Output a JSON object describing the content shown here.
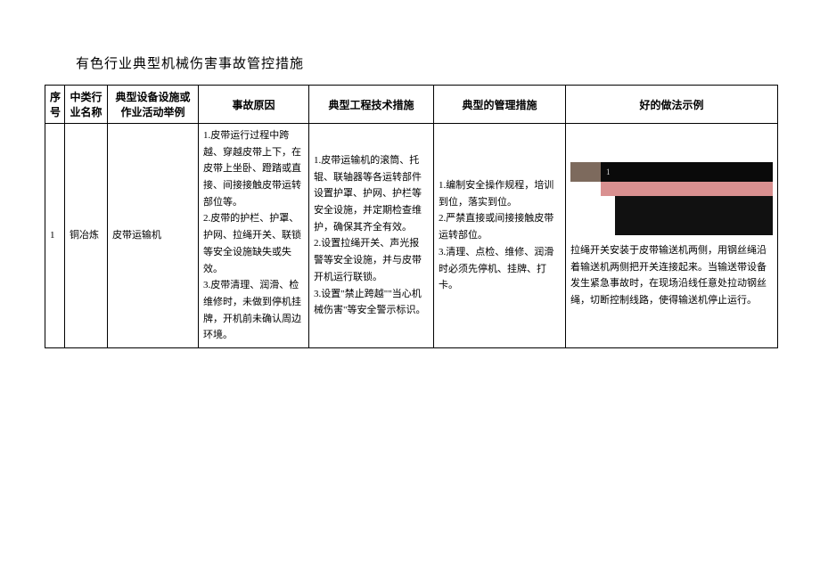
{
  "title": "有色行业典型机械伤害事故管控措施",
  "columns": {
    "seq": "序号",
    "industry": "中类行业名称",
    "equipment": "典型设备设施或作业活动举例",
    "cause": "事故原因",
    "engineering": "典型工程技术措施",
    "management": "典型的管理措施",
    "practice": "好的做法示例"
  },
  "rows": [
    {
      "seq": "1",
      "industry": "铜冶炼",
      "equipment": "皮带运输机",
      "cause": "1.皮带运行过程中跨越、穿越皮带上下，在皮带上坐卧、蹬踏或直接、间接接触皮带运转部位等。\n2.皮带的护栏、护罩、护网、拉绳开关、联锁等安全设施缺失或失效。\n3.皮带清理、润滑、检维修时，未做到停机挂牌，开机前未确认周边环境。",
      "engineering": "1.皮带运输机的滚筒、托辊、联轴器等各运转部件设置护罩、护网、护栏等安全设施，并定期检查维护，确保其齐全有效。\n2.设置拉绳开关、声光报警等安全设施，并与皮带开机运行联锁。\n3.设置\"禁止跨越\"\"当心机械伤害\"等安全警示标识。",
      "management": "1.编制安全操作规程，培训到位，落实到位。\n2.严禁直接或间接接触皮带运转部位。\n3.清理、点检、维修、润滑时必须先停机、挂牌、打卡。",
      "practice": "拉绳开关安装于皮带输送机两侧，用钢丝绳沿着输送机两侧把开关连接起来。当输送带设备发生紧急事故时，在现场沿线任意处拉动钢丝绳，切断控制线路，使得输送机停止运行。"
    }
  ]
}
